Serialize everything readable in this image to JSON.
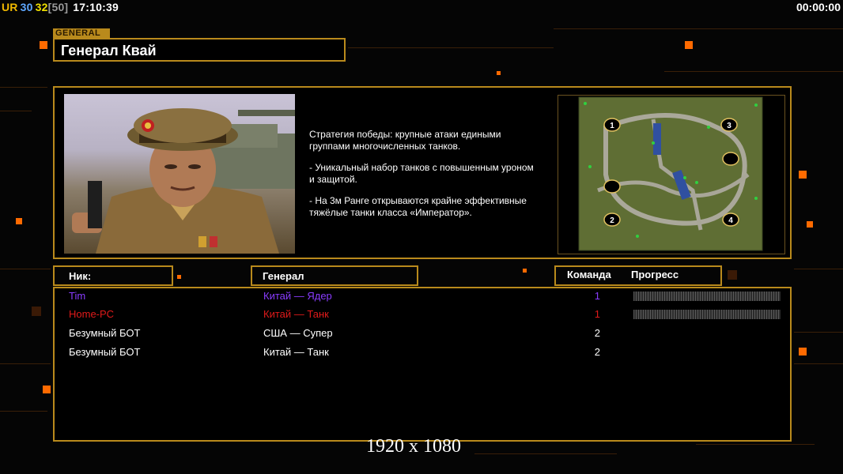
{
  "hud": {
    "tag_ur": "UR",
    "fps": "30",
    "fps2": "32",
    "fps_cap": "[50]",
    "clock": "17:10:39",
    "timer": "00:00:00",
    "colors": {
      "ur": "#f0b800",
      "fps": "#5fa8ff",
      "fps2": "#f0e000",
      "cap": "#9a9a9a"
    }
  },
  "general_tag": "GENERAL",
  "general_name": "Генерал Квай",
  "strategy": [
    "Стратегия победы: крупные атаки едиными\n группами многочисленных танков.",
    "- Уникальный набор танков с повышенным уроном\n и защитой.",
    "- На 3м Ранге открываются крайне эффективные\n тяжёлые танки класса «Император»."
  ],
  "map": {
    "spawns": [
      "1",
      "2",
      "3",
      "4"
    ]
  },
  "table": {
    "headers": {
      "nick": "Ник:",
      "general": "Генерал",
      "team": "Команда",
      "progress": "Прогресс"
    },
    "rows": [
      {
        "nick": "Tim",
        "general": "Китай — Ядер",
        "team": "1",
        "color": "#8a3cff",
        "progress": true
      },
      {
        "nick": "Home-PC",
        "general": "Китай — Танк",
        "team": "1",
        "color": "#e01a1a",
        "progress": true
      },
      {
        "nick": "Безумный БОТ",
        "general": "США — Супер",
        "team": "2",
        "color": "#ffffff",
        "progress": false
      },
      {
        "nick": "Безумный БОТ",
        "general": "Китай — Танк",
        "team": "2",
        "color": "#ffffff",
        "progress": false
      }
    ]
  },
  "resolution": "1920 x 1080",
  "accent": "#b98a1c"
}
